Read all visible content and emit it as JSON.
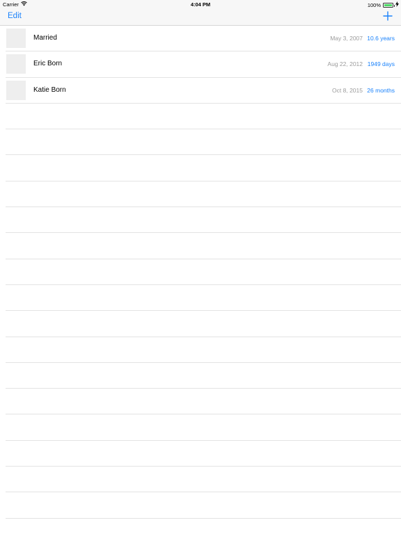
{
  "status_bar": {
    "carrier": "Carrier",
    "time": "4:04 PM",
    "battery_text": "100%",
    "battery_level": 1.0,
    "icons": [
      "wifi-icon",
      "battery-icon",
      "charging-bolt-icon"
    ]
  },
  "nav": {
    "edit_label": "Edit",
    "add_icon": "plus-icon"
  },
  "colors": {
    "accent": "#1a82fb",
    "secondary_text": "#9b9b9b",
    "separator": "#e3e3e3",
    "bar_background": "#f7f7f7",
    "battery": "#4cd964"
  },
  "events": [
    {
      "title": "Married",
      "date": "May 3, 2007",
      "elapsed": "10.6 years"
    },
    {
      "title": "Eric Born",
      "date": "Aug 22, 2012",
      "elapsed": "1949 days"
    },
    {
      "title": "Katie Born",
      "date": "Oct 8, 2015",
      "elapsed": "26 months"
    }
  ]
}
